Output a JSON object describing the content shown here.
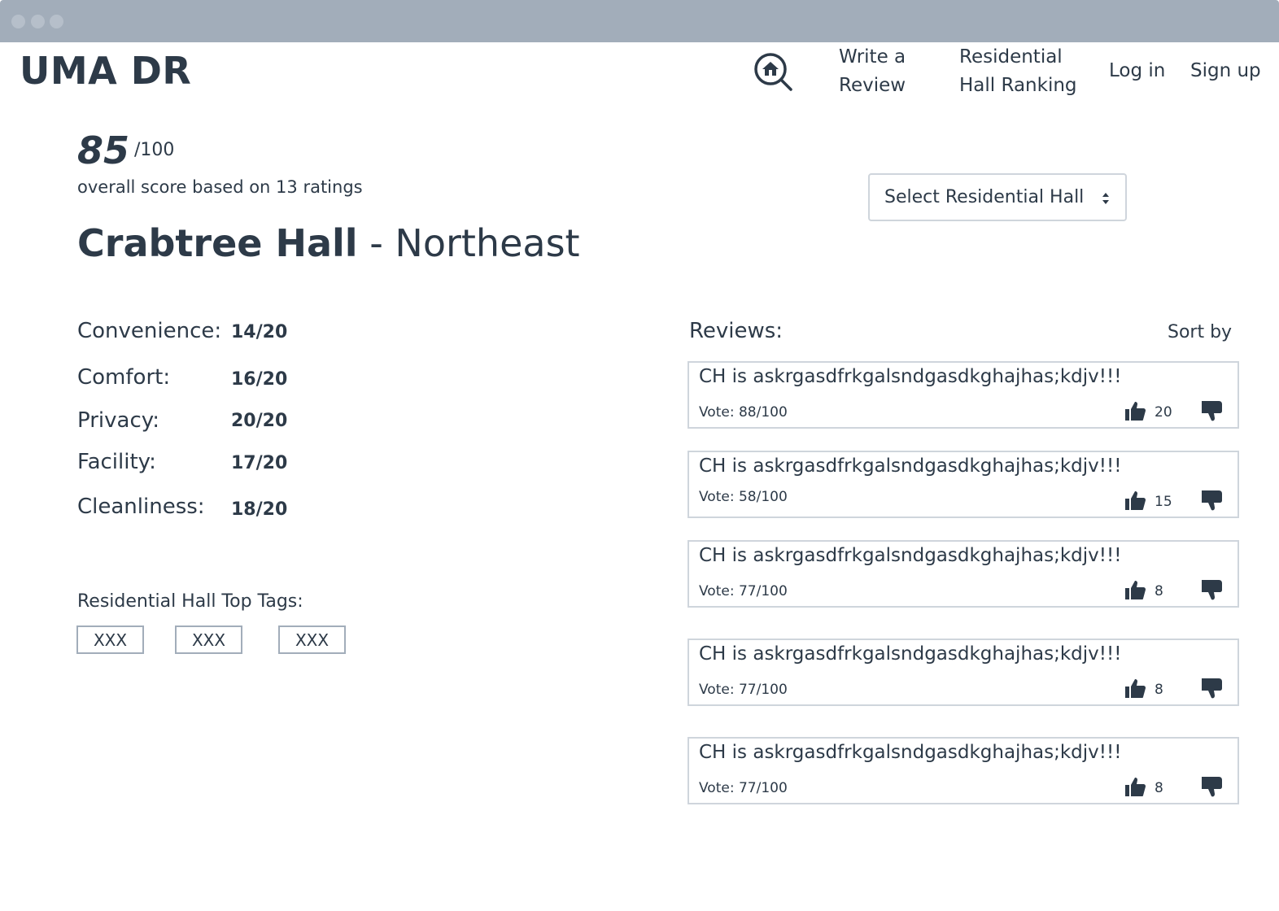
{
  "app": {
    "logo": "UMA DR"
  },
  "nav": {
    "write_review": [
      "Write a",
      "Review"
    ],
    "ranking": [
      "Residential",
      "Hall Ranking"
    ],
    "login": "Log in",
    "signup": "Sign up"
  },
  "score": {
    "value": "85",
    "max": "/100",
    "caption": "overall score based on 13 ratings"
  },
  "hall": {
    "name": "Crabtree Hall",
    "area": "- Northeast"
  },
  "select": {
    "label": "Select Residential Hall"
  },
  "categories": [
    {
      "label": "Convenience:",
      "value": "14/20"
    },
    {
      "label": "Comfort:",
      "value": "16/20"
    },
    {
      "label": "Privacy:",
      "value": "20/20"
    },
    {
      "label": "Facility:",
      "value": "17/20"
    },
    {
      "label": "Cleanliness:",
      "value": "18/20"
    }
  ],
  "tags": {
    "title": "Residential Hall Top Tags:",
    "items": [
      "XXX",
      "XXX",
      "XXX"
    ]
  },
  "reviews": {
    "title": "Reviews:",
    "sort_label": "Sort by",
    "items": [
      {
        "text": "CH is askrgasdfrkgalsndgasdkghajhas;kdjv!!!",
        "vote": "Vote: 88/100",
        "likes": "20"
      },
      {
        "text": "CH is askrgasdfrkgalsndgasdkghajhas;kdjv!!!",
        "vote": "Vote: 58/100",
        "likes": "15"
      },
      {
        "text": "CH is askrgasdfrkgalsndgasdkghajhas;kdjv!!!",
        "vote": "Vote: 77/100",
        "likes": "8"
      },
      {
        "text": "CH is askrgasdfrkgalsndgasdkghajhas;kdjv!!!",
        "vote": "Vote: 77/100",
        "likes": "8"
      },
      {
        "text": "CH is askrgasdfrkgalsndgasdkghajhas;kdjv!!!",
        "vote": "Vote: 77/100",
        "likes": "8"
      }
    ]
  },
  "icons": {
    "search_home": "home-search-icon",
    "select_arrows": "up-down-arrows-icon",
    "like": "thumbs-up-icon",
    "dislike": "thumbs-down-icon"
  },
  "colors": {
    "chrome": "#a2adba",
    "text": "#2d3a48",
    "border": "#cfd5dc"
  }
}
